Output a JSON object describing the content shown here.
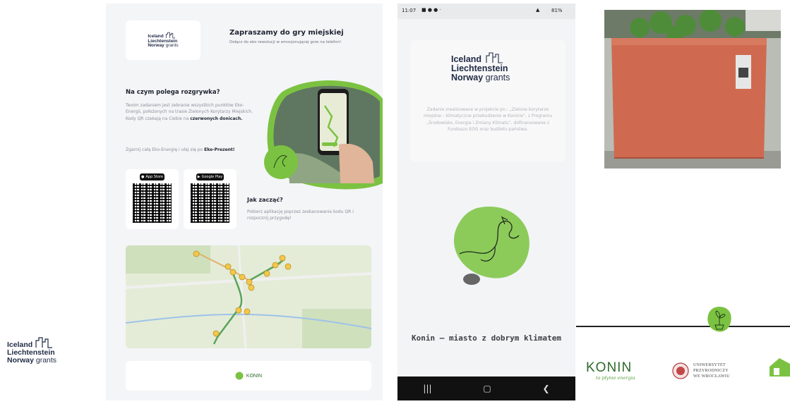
{
  "grants_logo": {
    "line1": "Iceland",
    "line2": "Liechtenstein",
    "line3a": "Norway",
    "line3b": "grants"
  },
  "poster": {
    "title": "Zapraszamy do gry miejskiej",
    "subtitle": "Dołącz do eko rewolucji w emocjonującej grze na telefon!",
    "section1_heading": "Na czym polega rozgrywka?",
    "section1_text_a": "Twoim zadaniem jest zebranie wszystkich punktów Eko-Energii, położonych na trasie Zielonych Korytarzy Miejskich. Kody QR czekają na Ciebie na ",
    "section1_text_bold": "czerwonych donicach.",
    "section1_text_c": "Zgarnij całą Eko-Energię i ułaj się po ",
    "section1_text_prize": "Eko-Prezent!",
    "section2_heading": "Jak zacząć?",
    "section2_text": "Pobierz aplikację poprzez zeskanowanie kodu QR i rozpocznij przygodę!",
    "app_store_label": "App Store",
    "google_play_label": "Google Play",
    "footer_brand": "KONIN"
  },
  "phone": {
    "status_time": "11:07",
    "status_right": "81%",
    "description": "Zadanie zrealizowane w projekcie pn.: „Zielone korytarze miejskie – klimatyczne przebudzenie w Koninie”, z Programu „Środowisko, Energia i Zmiany Klimatu”, dofinansowane z Funduszu EOG oraz budżetu państwa.",
    "tagline": "Konin – miasto z dobrym klimatem"
  },
  "partners": {
    "konin": "KONIN",
    "konin_slogan": "ta płynie energia",
    "university_line1": "UNIWERSYTET",
    "university_line2": "PRZYRODNICZY",
    "university_line3": "WE WROCŁAWIU"
  },
  "colors": {
    "green": "#7cc242",
    "dark_green": "#3f8f3a",
    "terracotta": "#cf6a50"
  }
}
